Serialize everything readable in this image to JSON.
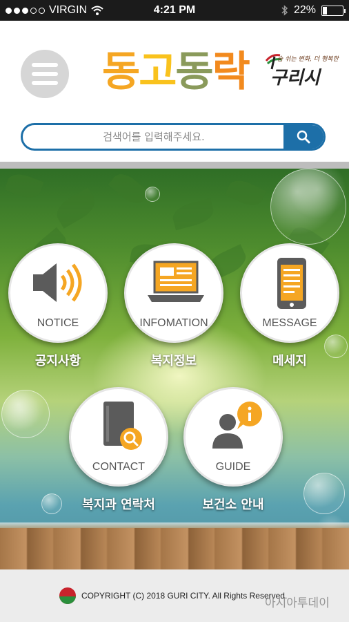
{
  "status_bar": {
    "carrier": "VIRGIN",
    "time": "4:21 PM",
    "battery": "22%",
    "battery_level": 0.22
  },
  "header": {
    "logo_chars": [
      "동",
      "고",
      "동",
      "락"
    ],
    "city_slogan": "숨 쉬는 변화, 더 행복한",
    "city_name": "구리시"
  },
  "search": {
    "placeholder": "검색어를 입력해주세요."
  },
  "menu": [
    {
      "caption": "NOTICE",
      "label": "공지사항",
      "icon": "speaker-icon"
    },
    {
      "caption": "INFOMATION",
      "label": "복지정보",
      "icon": "laptop-icon"
    },
    {
      "caption": "MESSAGE",
      "label": "메세지",
      "icon": "smartphone-icon"
    },
    {
      "caption": "CONTACT",
      "label": "복지과 연락처",
      "icon": "book-search-icon"
    },
    {
      "caption": "GUIDE",
      "label": "보건소 안내",
      "icon": "person-info-icon"
    }
  ],
  "colors": {
    "accent_orange": "#f5a623",
    "search_blue": "#1d6fa8",
    "icon_gray": "#5b5b5b"
  },
  "footer": {
    "copyright": "COPYRIGHT (C) 2018 GURI CITY. All Rights Reserved.",
    "watermark": "아시아투데이"
  }
}
